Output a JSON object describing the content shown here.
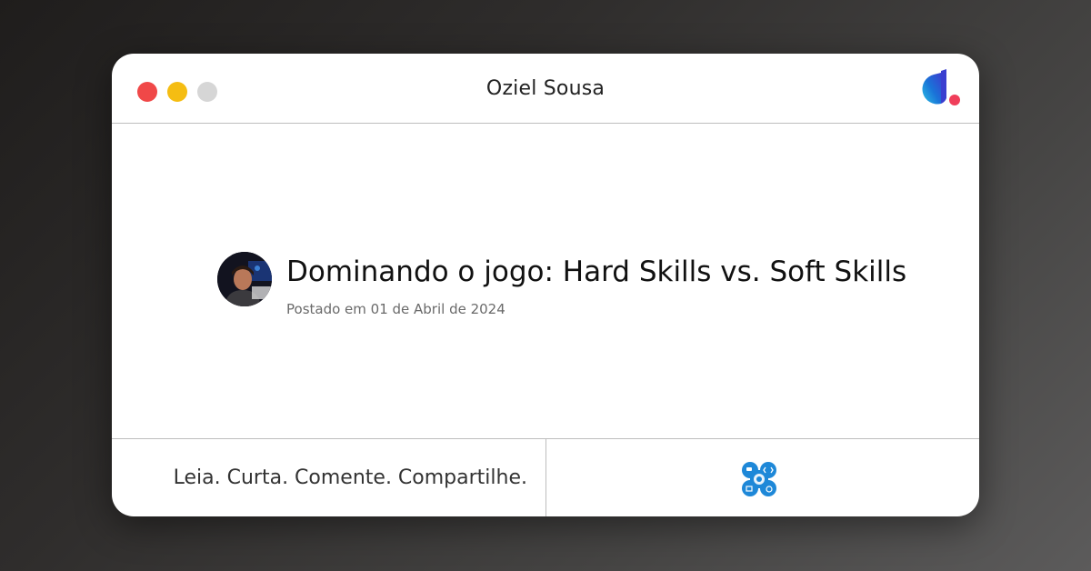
{
  "window": {
    "title": "Oziel Sousa"
  },
  "post": {
    "title": "Dominando o jogo: Hard Skills vs. Soft Skills",
    "date": "Postado em 01 de Abril de 2024"
  },
  "footer": {
    "tagline": "Leia. Curta. Comente. Compartilhe."
  },
  "colors": {
    "close": "#f04848",
    "minimize": "#f5bd12",
    "maximize": "#d6d6d6",
    "brand_blue": "#1a73d8",
    "brand_pink": "#f03e5a"
  },
  "icons": {
    "logo": "dio-logo-icon",
    "community": "community-badge-icon"
  }
}
